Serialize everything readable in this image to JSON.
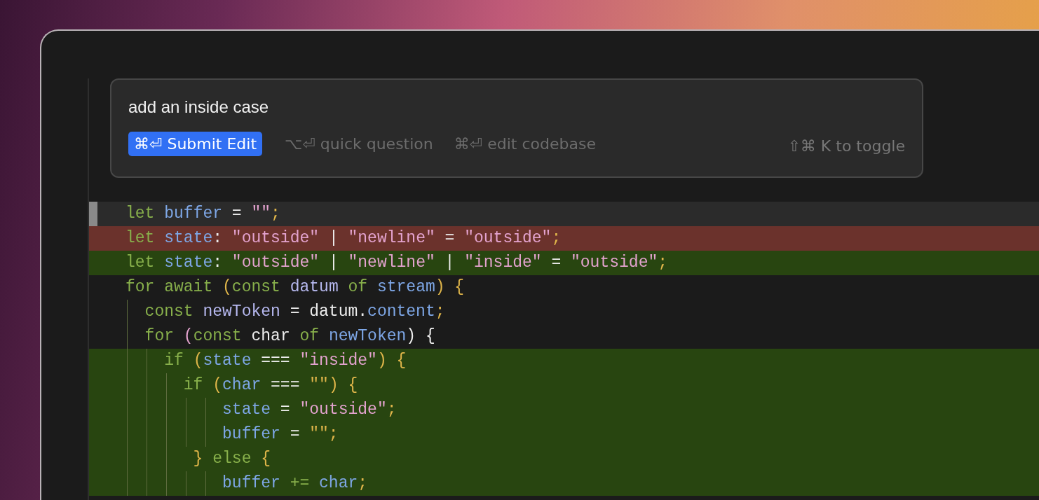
{
  "prompt": {
    "value": "add an inside case",
    "submit_button": "⌘⏎ Submit Edit",
    "hints": [
      "⌥⏎ quick question",
      "⌘⏎ edit codebase"
    ],
    "toggle_hint": "⇧⌘ K to toggle"
  },
  "code_lines": [
    {
      "kind": "current",
      "tokens": [
        {
          "text": "let",
          "kind": "keyword"
        },
        {
          "text": " buffer",
          "kind": "variable"
        },
        {
          "text": " = ",
          "kind": "operator"
        },
        {
          "text": "\"\"",
          "kind": "string"
        },
        {
          "text": ";",
          "kind": "punctuation"
        }
      ]
    },
    {
      "kind": "removed",
      "tokens": [
        {
          "text": "let",
          "kind": "keyword"
        },
        {
          "text": " state",
          "kind": "variable"
        },
        {
          "text": ": ",
          "kind": "operator"
        },
        {
          "text": "\"outside\"",
          "kind": "string"
        },
        {
          "text": " | ",
          "kind": "operator"
        },
        {
          "text": "\"newline\"",
          "kind": "string"
        },
        {
          "text": " = ",
          "kind": "operator"
        },
        {
          "text": "\"outside\"",
          "kind": "string"
        },
        {
          "text": ";",
          "kind": "punctuation"
        }
      ]
    },
    {
      "kind": "added",
      "tokens": [
        {
          "text": "let",
          "kind": "keyword"
        },
        {
          "text": " state",
          "kind": "variable"
        },
        {
          "text": ": ",
          "kind": "operator"
        },
        {
          "text": "\"outside\"",
          "kind": "string"
        },
        {
          "text": " | ",
          "kind": "operator"
        },
        {
          "text": "\"newline\"",
          "kind": "string"
        },
        {
          "text": " | ",
          "kind": "operator"
        },
        {
          "text": "\"inside\"",
          "kind": "string"
        },
        {
          "text": " = ",
          "kind": "operator"
        },
        {
          "text": "\"outside\"",
          "kind": "string"
        },
        {
          "text": ";",
          "kind": "punctuation"
        }
      ]
    },
    {
      "kind": "plain",
      "tokens": [
        {
          "text": "for await ",
          "kind": "keyword"
        },
        {
          "text": "(",
          "kind": "punctuation"
        },
        {
          "text": "const ",
          "kind": "keyword"
        },
        {
          "text": "datum ",
          "kind": "identifier"
        },
        {
          "text": "of ",
          "kind": "keyword"
        },
        {
          "text": "stream",
          "kind": "variable"
        },
        {
          "text": ") {",
          "kind": "punctuation"
        }
      ]
    },
    {
      "kind": "plain",
      "tokens": [
        {
          "text": "  const ",
          "kind": "keyword"
        },
        {
          "text": "newToken",
          "kind": "identifier"
        },
        {
          "text": " = datum.",
          "kind": "operator"
        },
        {
          "text": "content",
          "kind": "variable"
        },
        {
          "text": ";",
          "kind": "punctuation"
        }
      ]
    },
    {
      "kind": "plain",
      "tokens": [
        {
          "text": "  for ",
          "kind": "keyword"
        },
        {
          "text": "(",
          "kind": "string"
        },
        {
          "text": "const ",
          "kind": "keyword"
        },
        {
          "text": "char ",
          "kind": "operator"
        },
        {
          "text": "of ",
          "kind": "keyword"
        },
        {
          "text": "newToken",
          "kind": "variable"
        },
        {
          "text": ") {",
          "kind": "operator"
        }
      ]
    },
    {
      "kind": "added",
      "tokens": [
        {
          "text": "    if ",
          "kind": "keyword"
        },
        {
          "text": "(",
          "kind": "punctuation"
        },
        {
          "text": "state",
          "kind": "variable"
        },
        {
          "text": " === ",
          "kind": "operator"
        },
        {
          "text": "\"inside\"",
          "kind": "string"
        },
        {
          "text": ") {",
          "kind": "punctuation"
        }
      ]
    },
    {
      "kind": "added",
      "tokens": [
        {
          "text": "      if ",
          "kind": "keyword"
        },
        {
          "text": "(",
          "kind": "punctuation"
        },
        {
          "text": "char",
          "kind": "variable"
        },
        {
          "text": " === ",
          "kind": "operator"
        },
        {
          "text": "\"\"",
          "kind": "punctuation"
        },
        {
          "text": ") {",
          "kind": "punctuation"
        }
      ]
    },
    {
      "kind": "added",
      "tokens": [
        {
          "text": "          state",
          "kind": "variable"
        },
        {
          "text": " = ",
          "kind": "operator"
        },
        {
          "text": "\"outside\"",
          "kind": "string"
        },
        {
          "text": ";",
          "kind": "punctuation"
        }
      ]
    },
    {
      "kind": "added",
      "tokens": [
        {
          "text": "          buffer",
          "kind": "variable"
        },
        {
          "text": " = ",
          "kind": "operator"
        },
        {
          "text": "\"\";",
          "kind": "punctuation"
        }
      ]
    },
    {
      "kind": "added",
      "tokens": [
        {
          "text": "       } ",
          "kind": "punctuation"
        },
        {
          "text": "else ",
          "kind": "keyword"
        },
        {
          "text": "{",
          "kind": "punctuation"
        }
      ]
    },
    {
      "kind": "added",
      "tokens": [
        {
          "text": "          buffer",
          "kind": "variable"
        },
        {
          "text": " += ",
          "kind": "keyword"
        },
        {
          "text": "char",
          "kind": "variable"
        },
        {
          "text": ";",
          "kind": "punctuation"
        }
      ]
    }
  ]
}
